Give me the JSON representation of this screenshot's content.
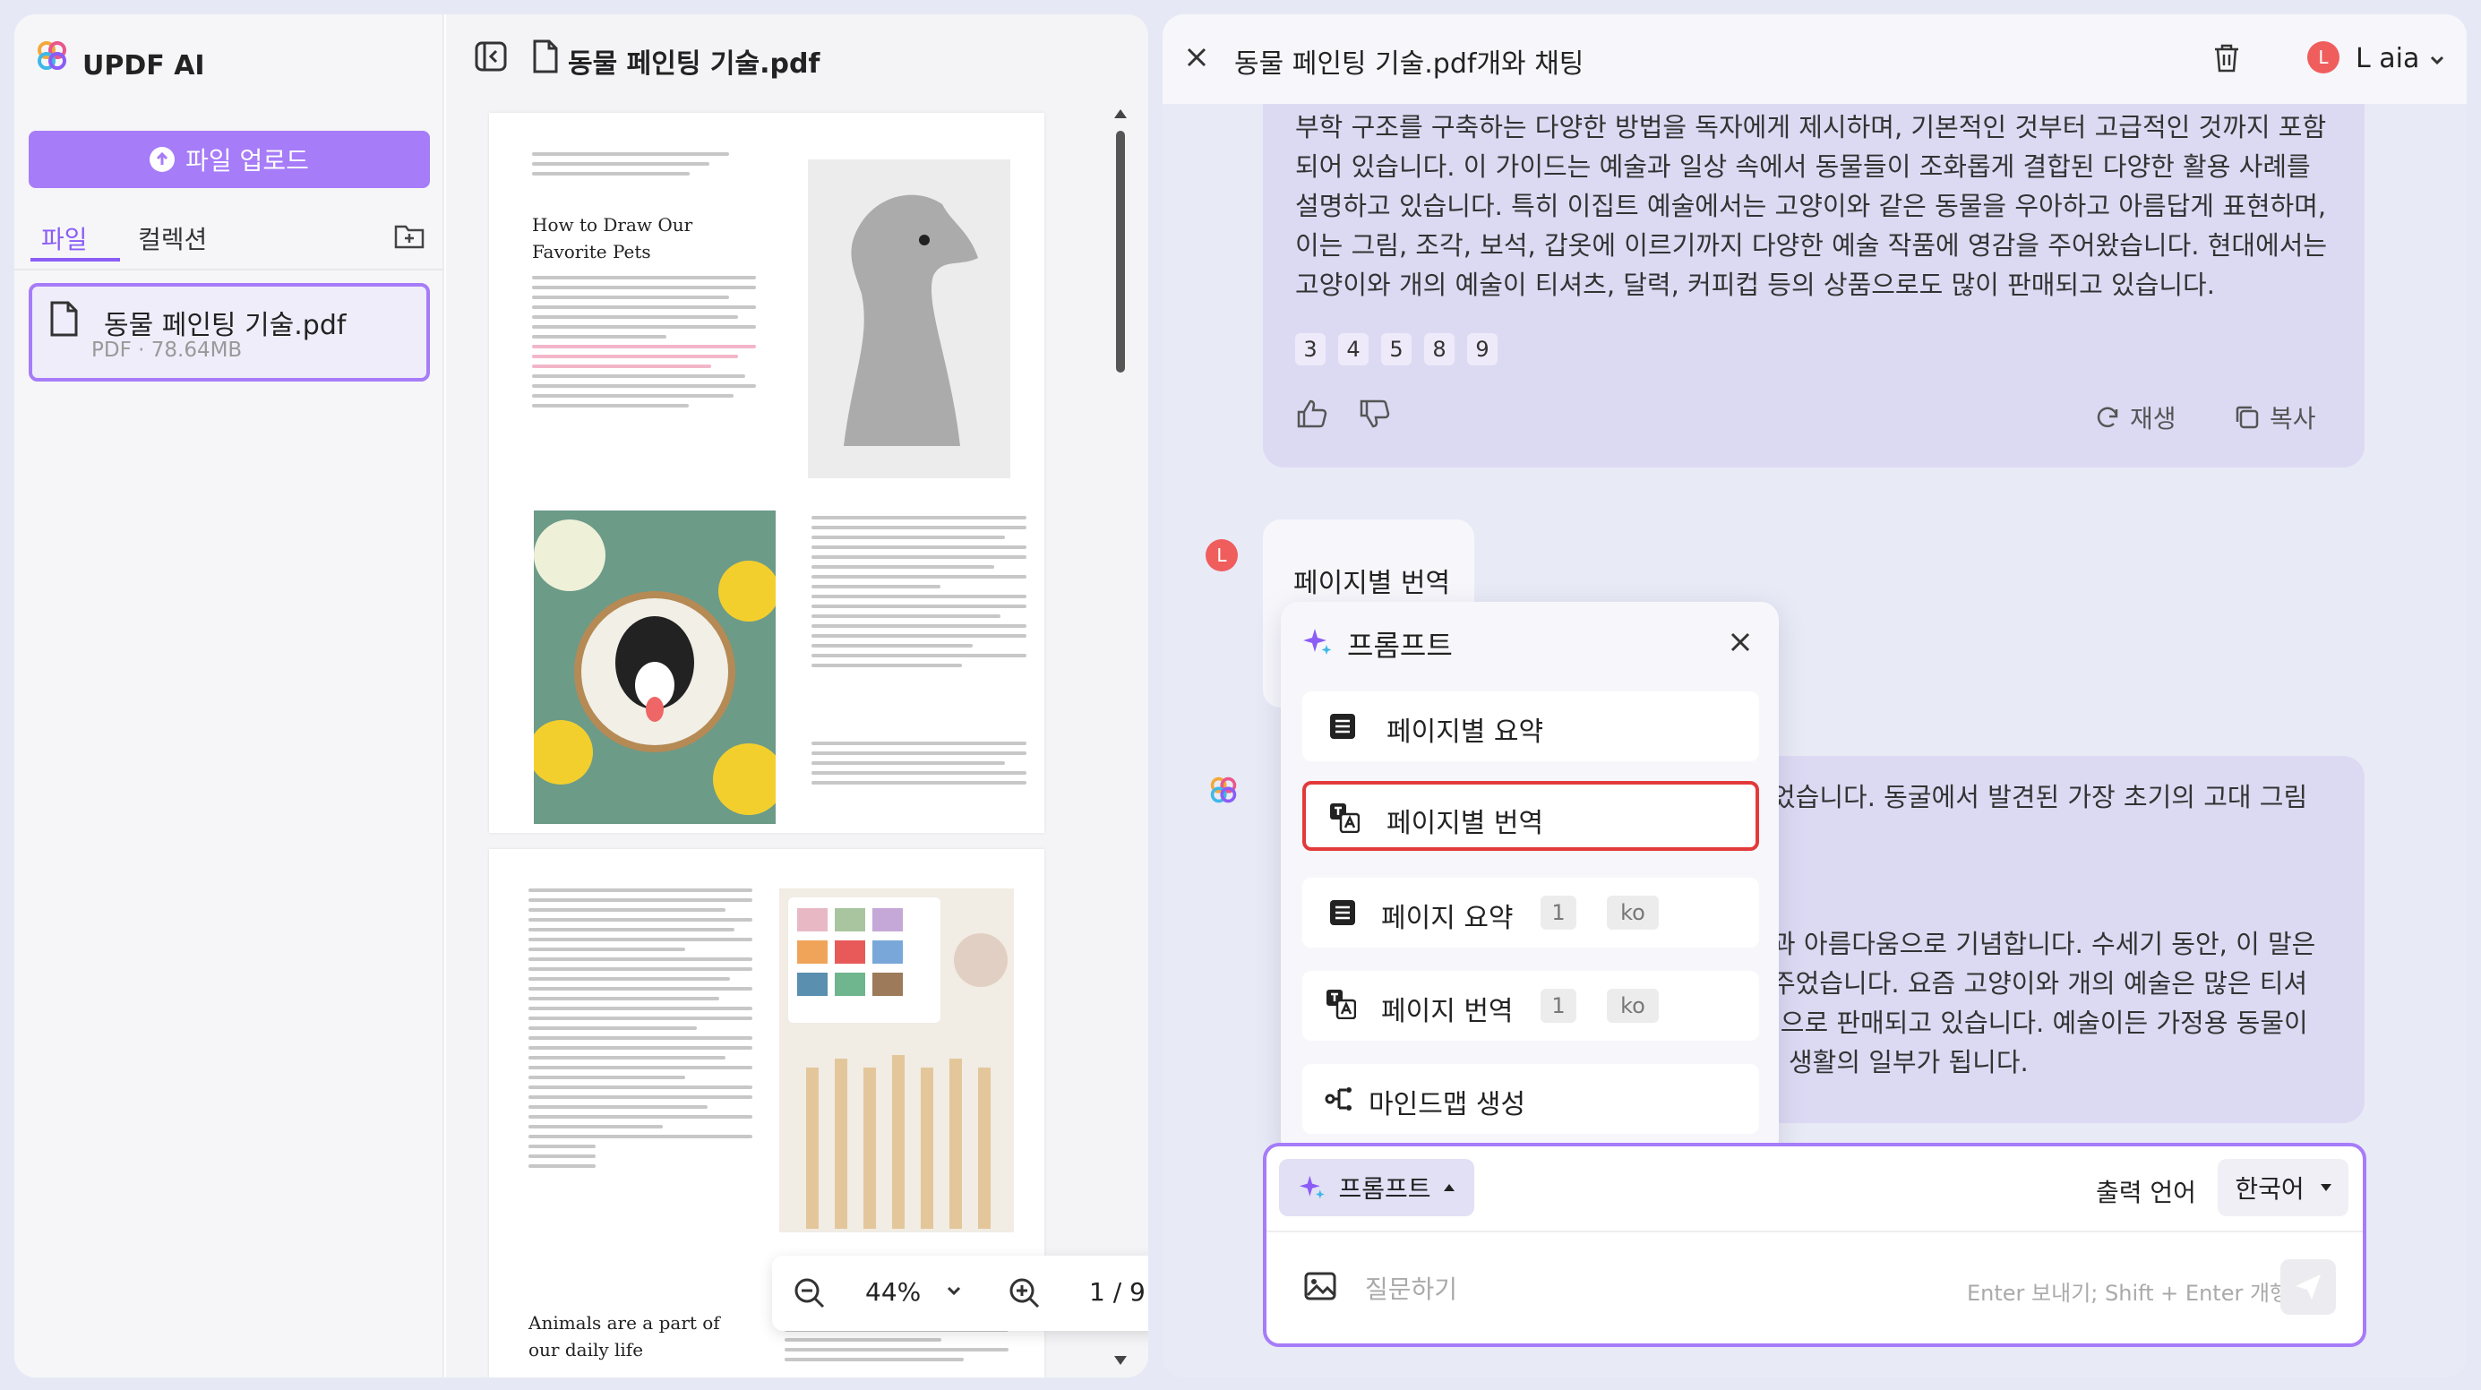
{
  "sidebar": {
    "brand": "UPDF AI",
    "upload_label": "파일 업로드",
    "tabs": [
      {
        "label": "파일"
      },
      {
        "label": "컬렉션"
      }
    ],
    "file": {
      "name": "동물 페인팅 기술.pdf",
      "meta": "PDF · 78.64MB"
    }
  },
  "viewer": {
    "title": "동물 페인팅 기술.pdf",
    "page1_heading": "How to Draw Our Favorite Pets",
    "page2_heading": "Animals are a part of our daily life",
    "zoom": "44%",
    "page_indicator": "1 / 9"
  },
  "chat": {
    "title": "동물 페인팅 기술.pdf개와 채팅",
    "user_name": "L aia",
    "user_initial": "L",
    "answer1": "부학 구조를 구축하는 다양한 방법을 독자에게 제시하며, 기본적인 것부터 고급적인 것까지 포함되어 있습니다. 이 가이드는 예술과 일상 속에서 동물들이 조화롭게 결합된 다양한 활용 사례를 설명하고 있습니다. 특히 이집트 예술에서는 고양이와 같은 동물을 우아하고 아름답게 표현하며, 이는 그림, 조각, 보석, 갑옷에 이르기까지 다양한 예술 작품에 영감을 주어왔습니다. 현대에서는 고양이와 개의 예술이 티셔츠, 달력, 커피컵 등의 상품으로도 많이 판매되고 있습니다.",
    "refs": [
      "3",
      "4",
      "5",
      "8",
      "9"
    ],
    "regenerate_label": "재생",
    "copy_label": "복사",
    "user_message": "페이지별 번역",
    "answer2_lines": [
      "었습니다. 동굴에서 발견된 가장 초기의 고대 그림",
      "",
      "",
      "과 아름다움으로 기념합니다. 수세기 동안, 이 말은",
      "주었습니다. 요즘 고양이와 개의 예술은 많은 티셔",
      "|으로 판매되고 있습니다. 예술이든 가정용 동물이",
      "; 생활의 일부가 됩니다."
    ]
  },
  "prompt_panel": {
    "title": "프롬프트",
    "items": [
      {
        "label": "페이지별 요약"
      },
      {
        "label": "페이지별 번역"
      },
      {
        "label": "페이지 요약",
        "page": "1",
        "lang": "ko"
      },
      {
        "label": "페이지 번역",
        "page": "1",
        "lang": "ko"
      },
      {
        "label": "마인드맵 생성"
      }
    ]
  },
  "input": {
    "prompt_button": "프롬프트",
    "output_language_label": "출력 언어",
    "output_language": "한국어",
    "placeholder": "질문하기",
    "hint": "Enter 보내기; Shift + Enter 개행"
  },
  "colors": {
    "accent": "#a67cf8",
    "highlight": "#e23a3a",
    "avatar": "#f05d5d"
  }
}
